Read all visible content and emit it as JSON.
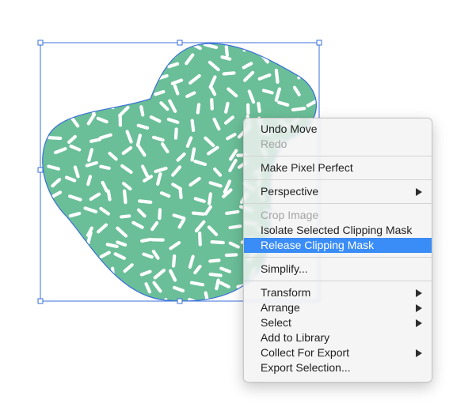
{
  "canvas": {
    "shape_fill": "#6bbf98",
    "shape_stroke": "#3a6fd8",
    "pattern_color": "#ffffff",
    "selection_color": "#3a6fd8"
  },
  "context_menu": {
    "highlight_color": "#3a8cf7",
    "groups": [
      [
        {
          "label": "Undo Move",
          "enabled": true
        },
        {
          "label": "Redo",
          "enabled": false
        }
      ],
      [
        {
          "label": "Make Pixel Perfect",
          "enabled": true
        }
      ],
      [
        {
          "label": "Perspective",
          "enabled": true,
          "submenu": true
        }
      ],
      [
        {
          "label": "Crop Image",
          "enabled": false
        },
        {
          "label": "Isolate Selected Clipping Mask",
          "enabled": true
        },
        {
          "label": "Release Clipping Mask",
          "enabled": true,
          "selected": true
        }
      ],
      [
        {
          "label": "Simplify...",
          "enabled": true
        }
      ],
      [
        {
          "label": "Transform",
          "enabled": true,
          "submenu": true
        },
        {
          "label": "Arrange",
          "enabled": true,
          "submenu": true
        },
        {
          "label": "Select",
          "enabled": true,
          "submenu": true
        },
        {
          "label": "Add to Library",
          "enabled": true
        },
        {
          "label": "Collect For Export",
          "enabled": true,
          "submenu": true
        },
        {
          "label": "Export Selection...",
          "enabled": true
        }
      ]
    ]
  }
}
